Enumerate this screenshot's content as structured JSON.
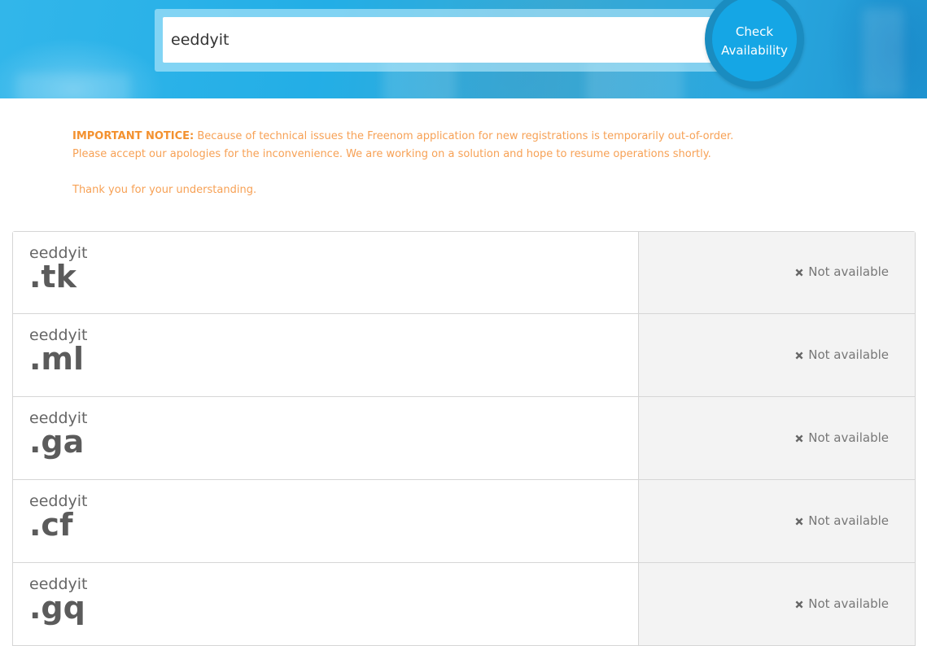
{
  "search": {
    "value": "eeddyit",
    "button_line1": "Check",
    "button_line2": "Availability"
  },
  "notice": {
    "label": "IMPORTANT NOTICE:",
    "line1": " Because of technical issues the Freenom application for new registrations is temporarily out-of-order.",
    "line2": "Please accept our apologies for the inconvenience. We are working on a solution and hope to resume operations shortly.",
    "thanks": "Thank you for your understanding."
  },
  "results": [
    {
      "name": "eeddyit",
      "tld": ".tk",
      "status": "Not available",
      "icon": "x-icon"
    },
    {
      "name": "eeddyit",
      "tld": ".ml",
      "status": "Not available",
      "icon": "x-icon"
    },
    {
      "name": "eeddyit",
      "tld": ".ga",
      "status": "Not available",
      "icon": "x-icon"
    },
    {
      "name": "eeddyit",
      "tld": ".cf",
      "status": "Not available",
      "icon": "x-icon"
    },
    {
      "name": "eeddyit",
      "tld": ".gq",
      "status": "Not available",
      "icon": "x-icon"
    }
  ],
  "colors": {
    "hero": "#23aee6",
    "button": "#15a6e5",
    "notice": "#f7a155",
    "status_bg": "#f3f3f3"
  }
}
